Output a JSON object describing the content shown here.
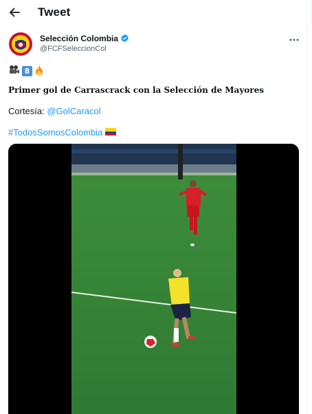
{
  "header": {
    "title": "Tweet"
  },
  "author": {
    "name": "Selección Colombia",
    "handle": "@FCFSeleccionCol"
  },
  "tweet": {
    "keycap_digit": "8",
    "headline": "Primer gol de Carrascrack con la Selección de Mayores",
    "courtesy_label": "Cortesía: ",
    "courtesy_mention": "@GolCaracol",
    "hashtag": "#TodosSomosColombia"
  },
  "colors": {
    "link": "#1d9bf0",
    "verified": "#1d9bf0",
    "secondary_text": "#536471",
    "pitch": "#3c8a3c",
    "colombia_yellow": "#fcd116",
    "colombia_blue": "#003893",
    "colombia_red": "#ce1126"
  },
  "icons": [
    "back-arrow-icon",
    "verified-badge-icon",
    "more-options-icon",
    "movie-camera-emoji",
    "keycap-eight-emoji",
    "fire-emoji",
    "colombia-flag-emoji"
  ]
}
